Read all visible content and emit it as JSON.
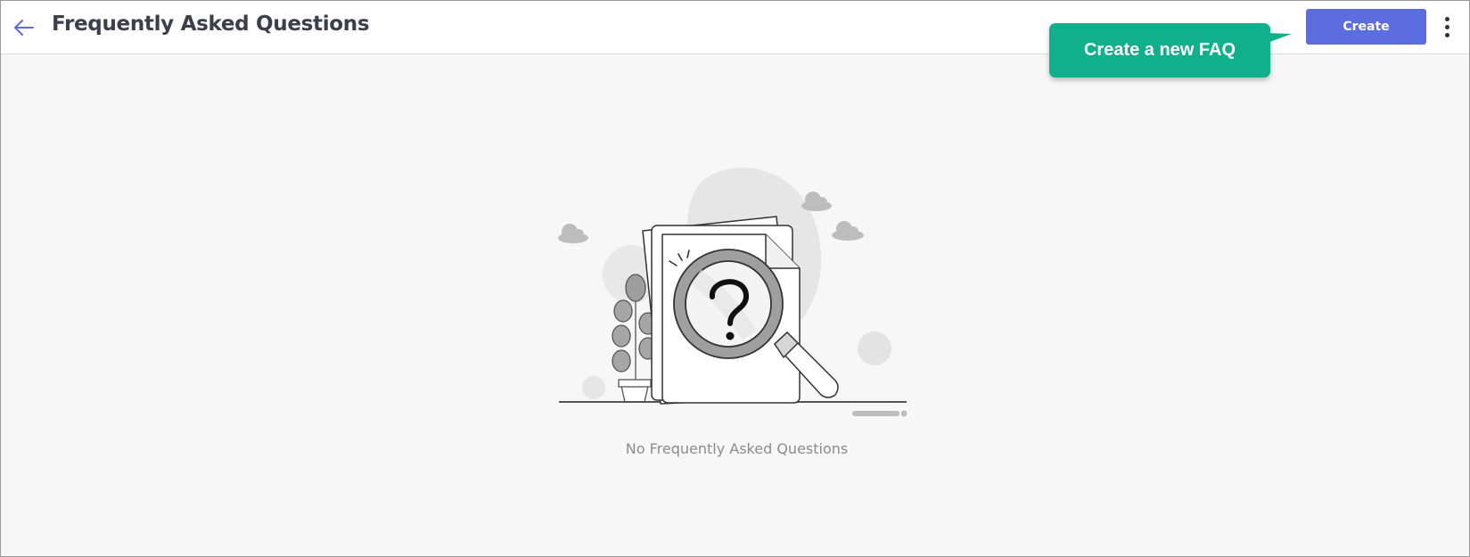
{
  "header": {
    "title": "Frequently Asked Questions",
    "create_label": "Create"
  },
  "tooltip": {
    "text": "Create a new FAQ"
  },
  "empty_state": {
    "message": "No Frequently Asked Questions"
  },
  "colors": {
    "accent": "#5b6ddf",
    "tooltip": "#10b08c",
    "title": "#3d3d4b",
    "muted_text": "#8c8c8c",
    "background": "#f7f7f7"
  },
  "icons": {
    "back": "arrow-left-icon",
    "more": "vertical-dots-icon",
    "empty": "magnifier-question-document-illustration"
  }
}
